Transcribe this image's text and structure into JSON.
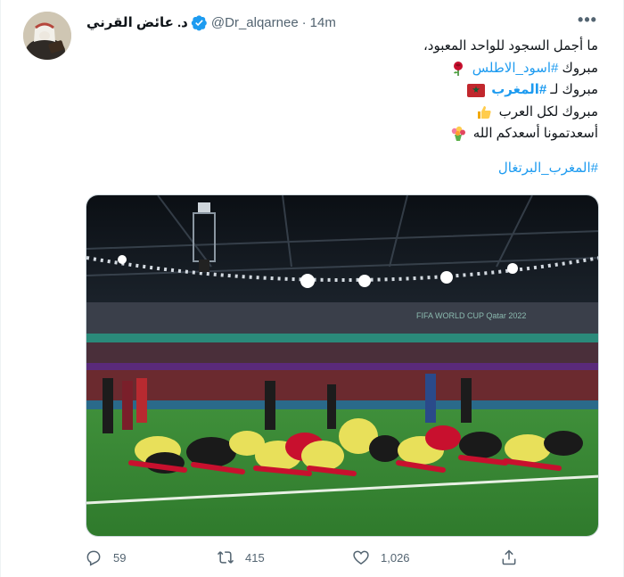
{
  "author": {
    "display_name": "د. عائض القرني",
    "handle": "@Dr_alqarnee",
    "separator": "·",
    "timestamp": "14m",
    "avatar_icon": "author-avatar",
    "verified_icon": "verified-badge-icon"
  },
  "menu": {
    "more_icon": "more-options-icon",
    "more_label": "•••"
  },
  "tweet": {
    "line1": "ما أجمل السجود للواحد المعبود،",
    "line2_prefix": "مبروك",
    "line2_hashtag": "#اسود_الاطلس",
    "line2_emoji": "rose-emoji",
    "line3_prefix": "مبروك لـ",
    "line3_hashtag": "#المغرب",
    "line3_emoji": "morocco-flag-emoji",
    "line4_text": "مبروك لكل العرب",
    "line4_emoji": "thumbs-up-emoji",
    "line5_text": "أسعدتمونا أسعدكم الله",
    "line5_emoji": "bouquet-emoji",
    "hashtag_footer": "#المغرب_البرتغال"
  },
  "media": {
    "type": "photo",
    "subject": "players-prostrating-on-pitch",
    "board_text": "FIFA WORLD CUP Qatar 2022"
  },
  "actions": {
    "reply_count": "59",
    "retweet_count": "415",
    "like_count": "1,026",
    "icons": [
      "reply-icon",
      "retweet-icon",
      "like-icon",
      "share-icon"
    ]
  },
  "colors": {
    "accent": "#1d9bf0",
    "text": "#0f1419",
    "secondary": "#536471",
    "border": "#cfd9de"
  }
}
